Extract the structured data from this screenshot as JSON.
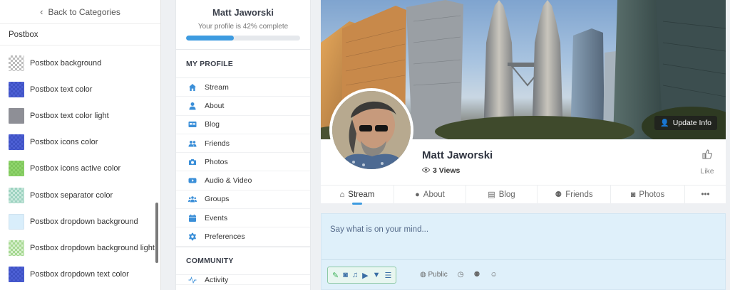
{
  "customizer": {
    "back_label": "Back to Categories",
    "section": "Postbox",
    "items": [
      {
        "label": "Postbox background",
        "swatch": "checker"
      },
      {
        "label": "Postbox text color",
        "swatch": "blue"
      },
      {
        "label": "Postbox text color light",
        "swatch": "gray"
      },
      {
        "label": "Postbox icons color",
        "swatch": "blue"
      },
      {
        "label": "Postbox icons active color",
        "swatch": "green"
      },
      {
        "label": "Postbox separator color",
        "swatch": "teal"
      },
      {
        "label": "Postbox dropdown background",
        "swatch": "light"
      },
      {
        "label": "Postbox dropdown background light",
        "swatch": "lgreen"
      },
      {
        "label": "Postbox dropdown text color",
        "swatch": "blue"
      }
    ]
  },
  "sidebar": {
    "name": "Matt Jaworski",
    "progress_text": "Your profile is 42% complete",
    "progress_percent": 42,
    "section_profile": "MY PROFILE",
    "items": [
      {
        "label": "Stream",
        "icon": "home-icon"
      },
      {
        "label": "About",
        "icon": "user-icon"
      },
      {
        "label": "Blog",
        "icon": "blog-icon"
      },
      {
        "label": "Friends",
        "icon": "friends-icon"
      },
      {
        "label": "Photos",
        "icon": "camera-icon"
      },
      {
        "label": "Audio & Video",
        "icon": "video-icon"
      },
      {
        "label": "Groups",
        "icon": "groups-icon"
      },
      {
        "label": "Events",
        "icon": "calendar-icon"
      },
      {
        "label": "Preferences",
        "icon": "gear-icon"
      }
    ],
    "section_community": "COMMUNITY",
    "community_partial": "Activity"
  },
  "profile": {
    "name": "Matt Jaworski",
    "views": "3 Views",
    "update_label": "Update Info",
    "like_label": "Like",
    "tabs": [
      {
        "label": "Stream",
        "icon": "home-icon",
        "active": true
      },
      {
        "label": "About",
        "icon": "user-icon",
        "active": false
      },
      {
        "label": "Blog",
        "icon": "blog-icon",
        "active": false
      },
      {
        "label": "Friends",
        "icon": "friends-icon",
        "active": false
      },
      {
        "label": "Photos",
        "icon": "camera-icon",
        "active": false
      },
      {
        "label": "•••",
        "icon": "more-icon",
        "active": false
      }
    ]
  },
  "postbox": {
    "placeholder": "Say what is on your mind...",
    "privacy": "Public"
  },
  "colors": {
    "accent": "#3d9be0",
    "postbox_bg": "#dff0fa",
    "icon_blue": "#3b8fd8"
  }
}
